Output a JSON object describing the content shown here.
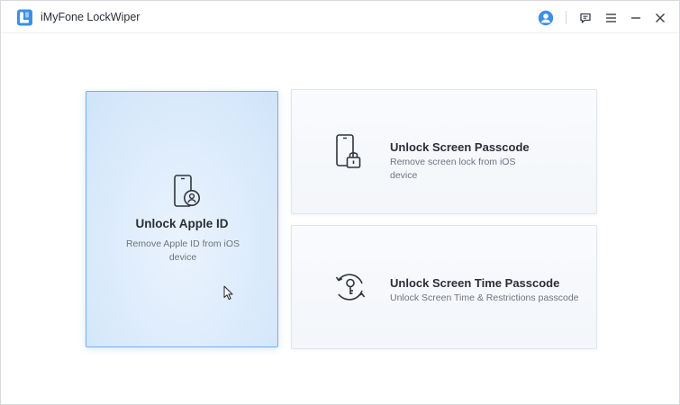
{
  "app": {
    "title": "iMyFone LockWiper",
    "accent_color": "#3d8fe8",
    "icon": "lockwiper-logo-icon"
  },
  "titlebar": {
    "buttons": [
      {
        "name": "account-icon",
        "label": "Account"
      },
      {
        "name": "feedback-icon",
        "label": "Feedback"
      },
      {
        "name": "menu-icon",
        "label": "Menu"
      },
      {
        "name": "minimize-icon",
        "label": "Minimize"
      },
      {
        "name": "close-icon",
        "label": "Close"
      }
    ]
  },
  "modes": [
    {
      "id": "unlock-apple-id",
      "title": "Unlock Apple ID",
      "description": "Remove Apple ID from iOS device",
      "icon": "phone-user-icon",
      "selected": true
    },
    {
      "id": "unlock-screen-passcode",
      "title": "Unlock Screen Passcode",
      "description": "Remove screen lock from iOS device",
      "icon": "phone-lock-icon",
      "selected": false
    },
    {
      "id": "unlock-screen-time-passcode",
      "title": "Unlock Screen Time Passcode",
      "description": "Unlock Screen Time & Restrictions passcode",
      "icon": "key-refresh-icon",
      "selected": false
    }
  ]
}
